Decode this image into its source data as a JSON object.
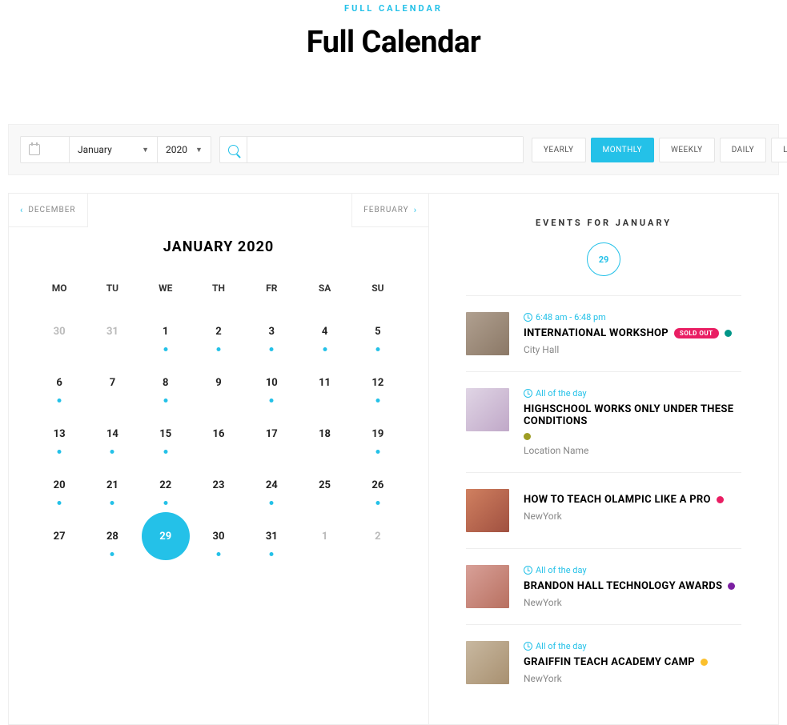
{
  "eyebrow": "FULL CALENDAR",
  "title": "Full Calendar",
  "toolbar": {
    "month": "January",
    "year": "2020",
    "search_placeholder": ""
  },
  "views": [
    {
      "key": "yearly",
      "label": "YEARLY",
      "active": false
    },
    {
      "key": "monthly",
      "label": "MONTHLY",
      "active": true
    },
    {
      "key": "weekly",
      "label": "WEEKLY",
      "active": false
    },
    {
      "key": "daily",
      "label": "DAILY",
      "active": false
    },
    {
      "key": "list",
      "label": "LIST",
      "active": false
    }
  ],
  "nav": {
    "prev": "DECEMBER",
    "next": "FEBRUARY"
  },
  "month_head": "JANUARY 2020",
  "dow": [
    "MO",
    "TU",
    "WE",
    "TH",
    "FR",
    "SA",
    "SU"
  ],
  "days": [
    {
      "n": "30",
      "dim": true
    },
    {
      "n": "31",
      "dim": true
    },
    {
      "n": "1",
      "dot": true
    },
    {
      "n": "2",
      "dot": true
    },
    {
      "n": "3",
      "dot": true
    },
    {
      "n": "4",
      "dot": true
    },
    {
      "n": "5",
      "dot": true
    },
    {
      "n": "6",
      "dot": true
    },
    {
      "n": "7"
    },
    {
      "n": "8",
      "dot": true
    },
    {
      "n": "9"
    },
    {
      "n": "10",
      "dot": true
    },
    {
      "n": "11"
    },
    {
      "n": "12",
      "dot": true
    },
    {
      "n": "13",
      "dot": true
    },
    {
      "n": "14",
      "dot": true
    },
    {
      "n": "15",
      "dot": true
    },
    {
      "n": "16"
    },
    {
      "n": "17"
    },
    {
      "n": "18"
    },
    {
      "n": "19",
      "dot": true
    },
    {
      "n": "20",
      "dot": true
    },
    {
      "n": "21",
      "dot": true
    },
    {
      "n": "22",
      "dot": true
    },
    {
      "n": "23"
    },
    {
      "n": "24",
      "dot": true
    },
    {
      "n": "25"
    },
    {
      "n": "26",
      "dot": true
    },
    {
      "n": "27"
    },
    {
      "n": "28",
      "dot": true
    },
    {
      "n": "29",
      "sel": true
    },
    {
      "n": "30",
      "dot": true
    },
    {
      "n": "31",
      "dot": true
    },
    {
      "n": "1",
      "dim": true
    },
    {
      "n": "2",
      "dim": true
    }
  ],
  "events_head": "EVENTS FOR JANUARY",
  "events_day": "29",
  "events": [
    {
      "time": "6:48 am - 6:48 pm",
      "title": "INTERNATIONAL WORKSHOP",
      "badge": "SOLD OUT",
      "color": "#009688",
      "loc": "City Hall",
      "thumb": "t1"
    },
    {
      "time": "All of the day",
      "title": "HIGHSCHOOL WORKS ONLY UNDER THESE CONDITIONS",
      "color": "#9e9d24",
      "loc": "Location Name",
      "thumb": "t2"
    },
    {
      "time": "",
      "title": "HOW TO TEACH OLAMPIC LIKE A PRO",
      "color": "#e91e63",
      "loc": "NewYork",
      "thumb": "t3"
    },
    {
      "time": "All of the day",
      "title": "BRANDON HALL TECHNOLOGY AWARDS",
      "color": "#7b1fa2",
      "loc": "NewYork",
      "thumb": "t4"
    },
    {
      "time": "All of the day",
      "title": "GRAIFFIN TEACH ACADEMY CAMP",
      "color": "#fbc02d",
      "loc": "NewYork",
      "thumb": "t5"
    }
  ]
}
